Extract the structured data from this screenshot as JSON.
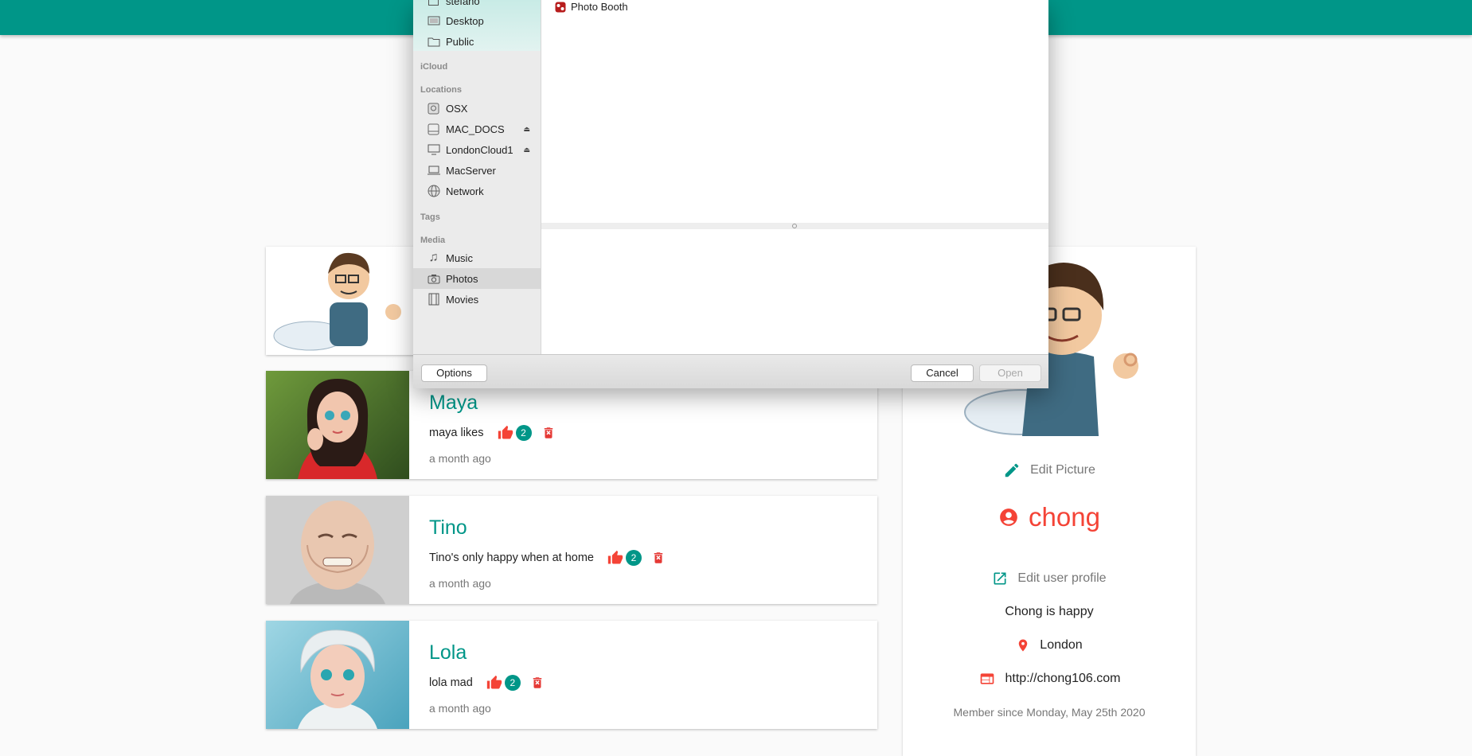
{
  "app": {
    "accent": "#009688",
    "like_color": "#f44336"
  },
  "screams": [
    {
      "name": "Maya",
      "body": "maya likes",
      "like_count": "2",
      "time": "a month ago",
      "avatar_icon": "woman-avatar"
    },
    {
      "name": "Tino",
      "body": "Tino's only happy when at home",
      "like_count": "2",
      "time": "a month ago",
      "avatar_icon": "old-man-avatar"
    },
    {
      "name": "Lola",
      "body": "lola mad",
      "like_count": "2",
      "time": "a month ago",
      "avatar_icon": "white-hair-woman-avatar"
    }
  ],
  "profile": {
    "edit_picture": "Edit Picture",
    "handle": "chong",
    "edit_profile": "Edit user profile",
    "bio": "Chong is happy",
    "location": "London",
    "website": "http://chong106.com",
    "member_since": "Member since Monday, May 25th 2020"
  },
  "dialog": {
    "favorites": [
      {
        "label": "stefano",
        "icon": "home-icon"
      },
      {
        "label": "Desktop",
        "icon": "desktop-icon"
      },
      {
        "label": "Public",
        "icon": "folder-icon"
      }
    ],
    "icloud_heading": "iCloud",
    "locations_heading": "Locations",
    "locations": [
      {
        "label": "OSX",
        "icon": "disk-icon",
        "eject": ""
      },
      {
        "label": "MAC_DOCS",
        "icon": "drive-icon",
        "eject": "⏏"
      },
      {
        "label": "LondonCloud1",
        "icon": "display-icon",
        "eject": "⏏"
      },
      {
        "label": "MacServer",
        "icon": "server-icon",
        "eject": ""
      },
      {
        "label": "Network",
        "icon": "globe-icon",
        "eject": ""
      }
    ],
    "tags_heading": "Tags",
    "media_heading": "Media",
    "media": [
      {
        "label": "Music",
        "icon": "music-icon"
      },
      {
        "label": "Photos",
        "icon": "camera-icon",
        "selected": true
      },
      {
        "label": "Movies",
        "icon": "film-icon"
      }
    ],
    "files": [
      {
        "label": "Photo Booth",
        "icon": "photo-booth-icon"
      }
    ],
    "options_label": "Options",
    "cancel_label": "Cancel",
    "open_label": "Open"
  }
}
